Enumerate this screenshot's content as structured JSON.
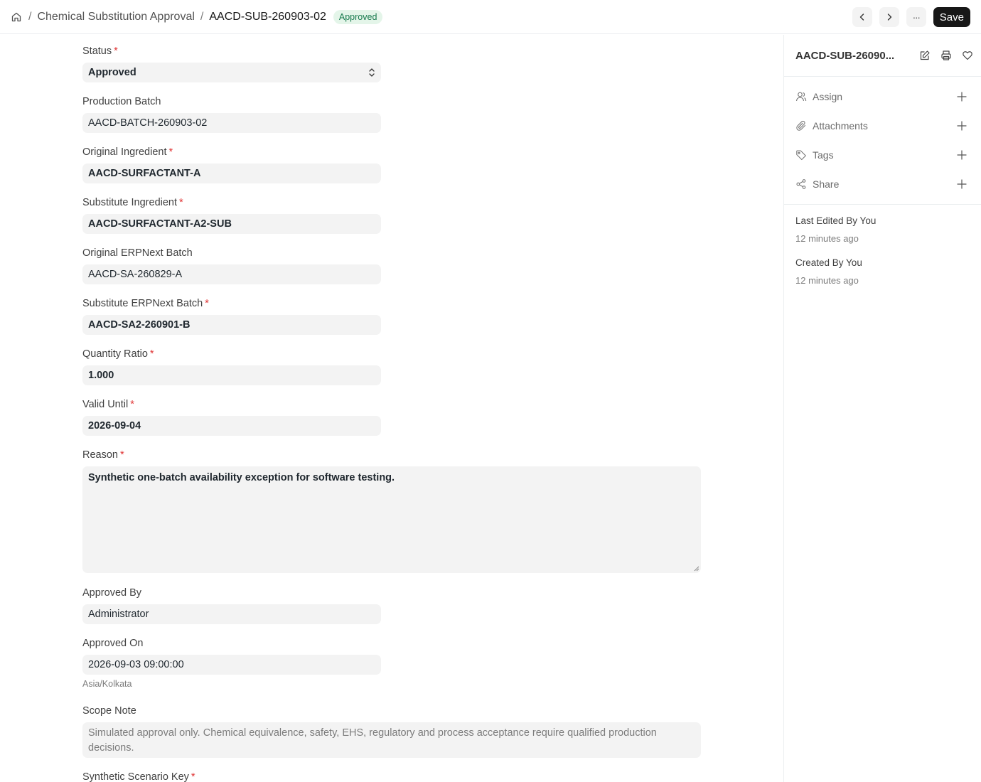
{
  "breadcrumb": {
    "doctype": "Chemical Substitution Approval",
    "doc_name": "AACD-SUB-260903-02",
    "status_badge": "Approved"
  },
  "toolbar": {
    "more_label": "···",
    "save_label": "Save"
  },
  "form": {
    "status": {
      "label": "Status",
      "value": "Approved",
      "required": "*"
    },
    "production_batch": {
      "label": "Production Batch",
      "value": "AACD-BATCH-260903-02"
    },
    "original_ingredient": {
      "label": "Original Ingredient",
      "value": "AACD-SURFACTANT-A",
      "required": "*"
    },
    "substitute_ingredient": {
      "label": "Substitute Ingredient",
      "value": "AACD-SURFACTANT-A2-SUB",
      "required": "*"
    },
    "original_batch": {
      "label": "Original ERPNext Batch",
      "value": "AACD-SA-260829-A"
    },
    "substitute_batch": {
      "label": "Substitute ERPNext Batch",
      "value": "AACD-SA2-260901-B",
      "required": "*"
    },
    "quantity_ratio": {
      "label": "Quantity Ratio",
      "value": "1.000",
      "required": "*"
    },
    "valid_until": {
      "label": "Valid Until",
      "value": "2026-09-04",
      "required": "*"
    },
    "reason": {
      "label": "Reason",
      "value": "Synthetic one-batch availability exception for software testing.",
      "required": "*"
    },
    "approved_by": {
      "label": "Approved By",
      "value": "Administrator"
    },
    "approved_on": {
      "label": "Approved On",
      "value": "2026-09-03 09:00:00",
      "hint": "Asia/Kolkata"
    },
    "scope_note": {
      "label": "Scope Note",
      "value": "Simulated approval only. Chemical equivalence, safety, EHS, regulatory and process acceptance require qualified production decisions."
    },
    "scenario_key": {
      "label": "Synthetic Scenario Key",
      "required": "*"
    }
  },
  "sidebar": {
    "title": "AACD-SUB-26090...",
    "items": [
      {
        "label": "Assign",
        "icon": "user-icon"
      },
      {
        "label": "Attachments",
        "icon": "paperclip-icon"
      },
      {
        "label": "Tags",
        "icon": "tag-icon"
      },
      {
        "label": "Share",
        "icon": "share-icon"
      }
    ],
    "last_edited": {
      "title": "Last Edited By You",
      "time": "12 minutes ago"
    },
    "created": {
      "title": "Created By You",
      "time": "12 minutes ago"
    }
  }
}
